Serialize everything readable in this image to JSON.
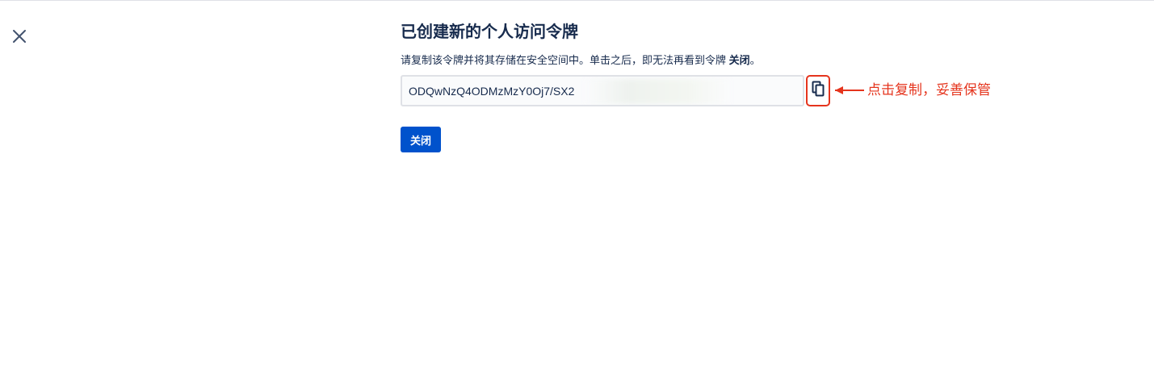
{
  "dialog": {
    "title": "已创建新的个人访问令牌",
    "description_prefix": "请复制该令牌并将其存储在安全空间中。单击之后，即无法再看到令牌 ",
    "description_bold": "关闭",
    "description_suffix": "。",
    "token_value": "ODQwNzQ4ODMzMzY0Oj7/SX2",
    "close_button_label": "关闭"
  },
  "annotation": {
    "text": "点击复制，妥善保管",
    "color": "#e5341d"
  },
  "icons": {
    "close": "close-icon",
    "copy": "copy-icon",
    "arrow": "arrow-left-icon"
  },
  "colors": {
    "primary": "#0052cc",
    "text": "#172b4d",
    "border": "#dfe1e6",
    "annotation": "#e5341d"
  }
}
